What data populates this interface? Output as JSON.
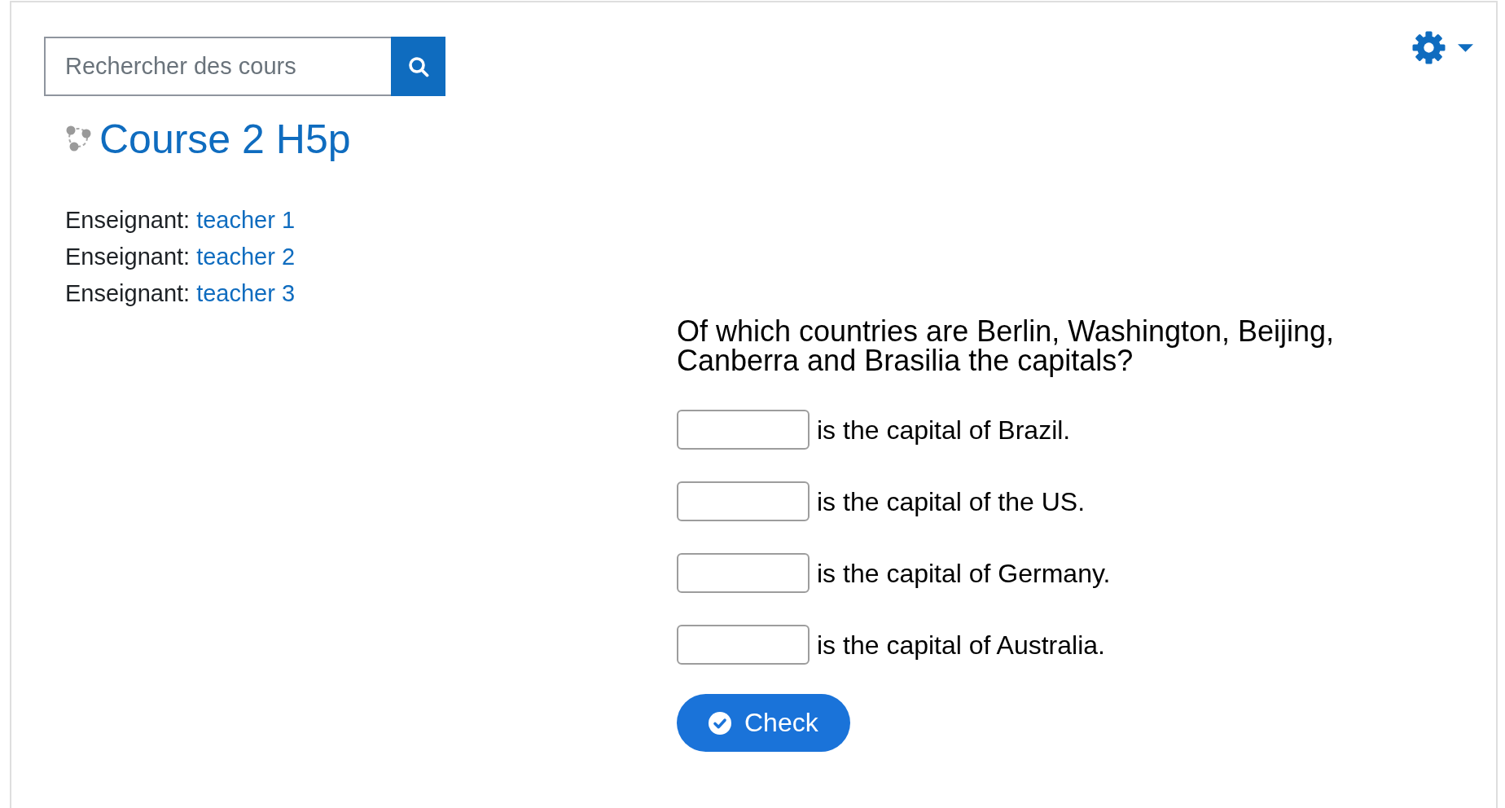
{
  "search": {
    "placeholder": "Rechercher des cours"
  },
  "course": {
    "title": "Course 2 H5p"
  },
  "teachers": [
    {
      "role": "Enseignant:",
      "name": "teacher 1"
    },
    {
      "role": "Enseignant:",
      "name": "teacher 2"
    },
    {
      "role": "Enseignant:",
      "name": "teacher 3"
    }
  ],
  "quiz": {
    "question": "Of which countries are Berlin, Washington, Beijing, Canberra and Brasilia the capitals?",
    "blanks": [
      {
        "text": "is the capital of Brazil."
      },
      {
        "text": "is the capital of the US."
      },
      {
        "text": "is the capital of Germany."
      },
      {
        "text": "is the capital of Australia."
      }
    ],
    "check_button": {
      "label": "Check"
    }
  }
}
